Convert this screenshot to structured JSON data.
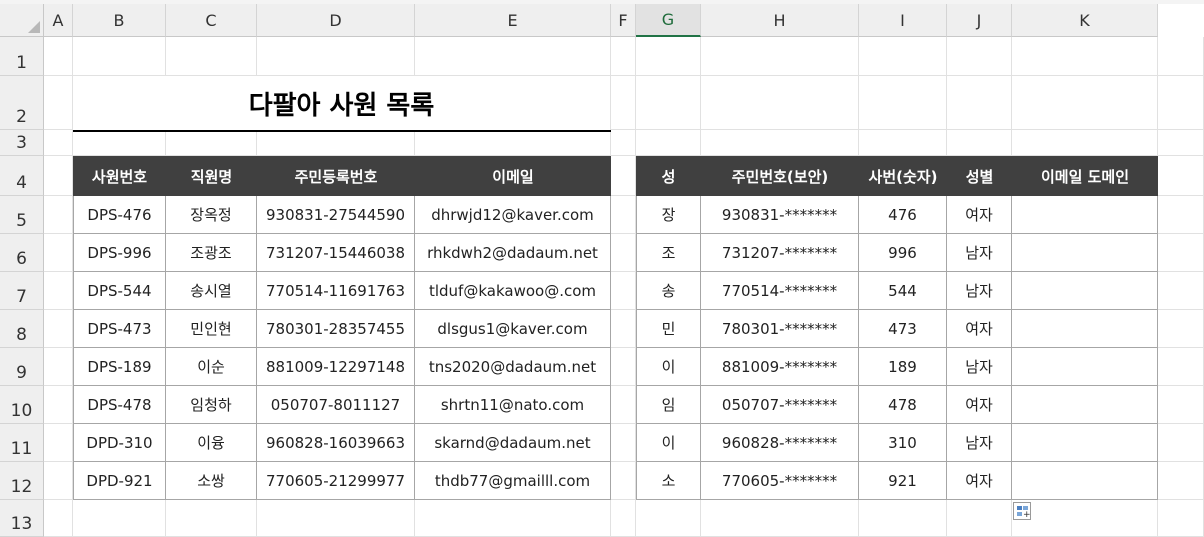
{
  "columns": [
    "A",
    "B",
    "C",
    "D",
    "E",
    "F",
    "G",
    "H",
    "I",
    "J",
    "K"
  ],
  "rows": [
    "1",
    "2",
    "3",
    "4",
    "5",
    "6",
    "7",
    "8",
    "9",
    "10",
    "11",
    "12",
    "13"
  ],
  "title": "다팔아 사원 목록",
  "table1": {
    "headers": [
      "사원번호",
      "직원명",
      "주민등록번호",
      "이메일"
    ],
    "rows": [
      [
        "DPS-476",
        "장옥정",
        "930831-27544590",
        "dhrwjd12@kaver.com"
      ],
      [
        "DPS-996",
        "조광조",
        "731207-15446038",
        "rhkdwh2@dadaum.net"
      ],
      [
        "DPS-544",
        "송시열",
        "770514-11691763",
        "tlduf@kakawoo@.com"
      ],
      [
        "DPS-473",
        "민인현",
        "780301-28357455",
        "dlsgus1@kaver.com"
      ],
      [
        "DPS-189",
        "이순",
        "881009-12297148",
        "tns2020@dadaum.net"
      ],
      [
        "DPS-478",
        "임청하",
        "050707-8011127",
        "shrtn11@nato.com"
      ],
      [
        "DPD-310",
        "이융",
        "960828-16039663",
        "skarnd@dadaum.net"
      ],
      [
        "DPD-921",
        "소쌍",
        "770605-21299977",
        "thdb77@gmailll.com"
      ]
    ]
  },
  "table2": {
    "headers": [
      "성",
      "주민번호(보안)",
      "사번(숫자)",
      "성별",
      "이메일 도메인"
    ],
    "rows": [
      [
        "장",
        "930831-*******",
        "476",
        "여자",
        ""
      ],
      [
        "조",
        "731207-*******",
        "996",
        "남자",
        ""
      ],
      [
        "송",
        "770514-*******",
        "544",
        "남자",
        ""
      ],
      [
        "민",
        "780301-*******",
        "473",
        "여자",
        ""
      ],
      [
        "이",
        "881009-*******",
        "189",
        "남자",
        ""
      ],
      [
        "임",
        "050707-*******",
        "478",
        "여자",
        ""
      ],
      [
        "이",
        "960828-*******",
        "310",
        "남자",
        ""
      ],
      [
        "소",
        "770605-*******",
        "921",
        "여자",
        ""
      ]
    ]
  },
  "selected_column": "G",
  "header_fill": "#404040",
  "selection_accent": "#217346",
  "quick_analysis_icon": "quick-analysis-icon"
}
